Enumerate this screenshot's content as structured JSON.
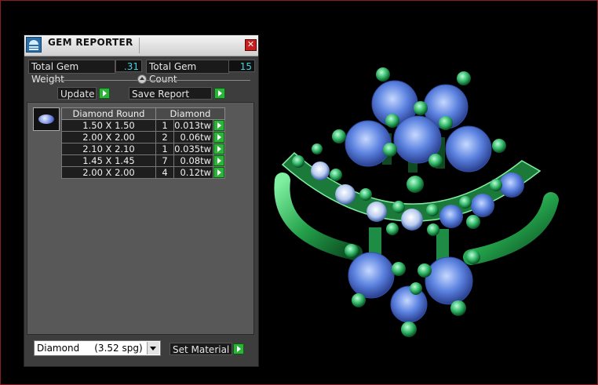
{
  "panel": {
    "title": "GEM REPORTER",
    "close_symbol": "✕",
    "total_weight_label": "Total Gem Weight",
    "total_weight_value": ".31",
    "total_count_label": "Total Gem Count",
    "total_count_value": "15",
    "update_label": "Update",
    "save_report_label": "Save Report",
    "set_material_label": "Set Material",
    "material_selected": "Diamond     (3.52 spg)"
  },
  "table": {
    "headers": [
      "Diamond Round",
      "Diamond"
    ],
    "rows": [
      {
        "size": "1.50 X 1.50",
        "qty": "1",
        "weight": "0.013tw"
      },
      {
        "size": "2.00 X 2.00",
        "qty": "2",
        "weight": "0.06tw"
      },
      {
        "size": "2.10 X 2.10",
        "qty": "1",
        "weight": "0.035tw"
      },
      {
        "size": "1.45 X 1.45",
        "qty": "7",
        "weight": "0.08tw"
      },
      {
        "size": "2.00 X 2.00",
        "qty": "4",
        "weight": "0.12tw"
      }
    ]
  },
  "colors": {
    "border_accent": "#8a1c22",
    "value_text": "#48d0e0",
    "arrow_green": "#2db33a",
    "metal_green": "#2aa84a",
    "gem_blue": "#5b82e0"
  },
  "icons": {
    "app": "gem-reporter-icon",
    "close": "close-icon",
    "run": "play-arrow-icon",
    "dropdown": "chevron-down-icon",
    "thumb": "gem-thumbnail-icon"
  }
}
